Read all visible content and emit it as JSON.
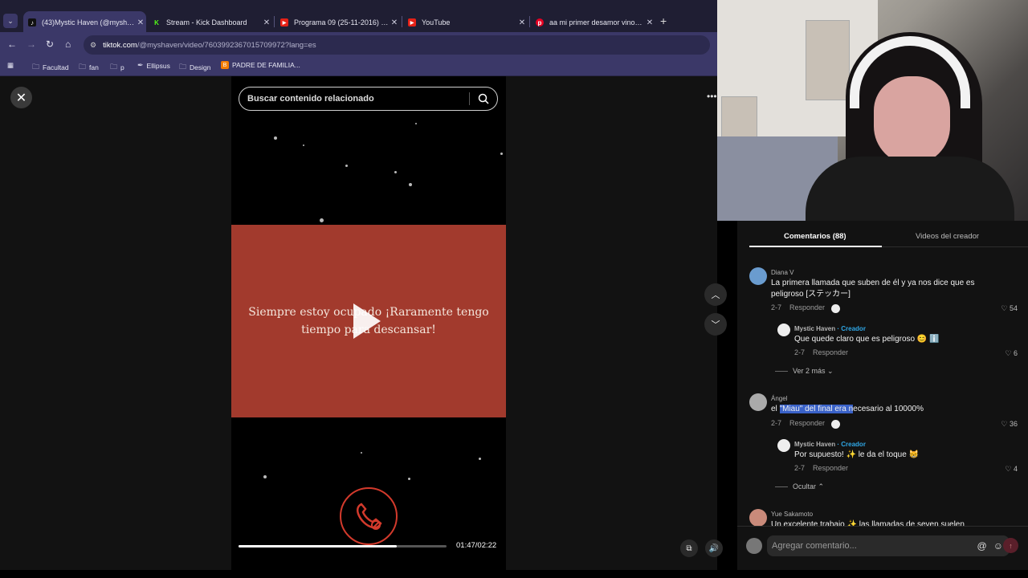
{
  "browser": {
    "tabs": [
      {
        "title": "(43)Mystic Haven (@myshaven",
        "favicon": "tiktok-icon",
        "active": true
      },
      {
        "title": "Stream - Kick Dashboard",
        "favicon": "kick-icon",
        "active": false
      },
      {
        "title": "Programa 09 (25-11-2016) Pes",
        "favicon": "youtube-icon",
        "active": false
      },
      {
        "title": "YouTube",
        "favicon": "youtube-icon",
        "active": false
      },
      {
        "title": "aa mi primer desamor vino de",
        "favicon": "pinterest-icon",
        "active": false
      }
    ],
    "new_tab": "+",
    "url_host": "tiktok.com",
    "url_path": "/@myshaven/video/7603992367015709972?lang=es",
    "bookmarks": [
      {
        "label": "Facultad",
        "icon": "folder-icon"
      },
      {
        "label": "fan",
        "icon": "folder-icon"
      },
      {
        "label": "p",
        "icon": "folder-icon"
      },
      {
        "label": "Ellipsus",
        "icon": "ellipsus-icon"
      },
      {
        "label": "Design",
        "icon": "folder-icon"
      },
      {
        "label": "PADRE DE FAMILIA...",
        "icon": "blogger-icon"
      }
    ]
  },
  "video": {
    "search_placeholder": "Buscar contenido relacionado",
    "card_text": "Siempre estoy ocupado ¡Raramente tengo tiempo para descansar!",
    "time": "01:47/02:22",
    "progress": 0.76,
    "card_color": "#a23a2d",
    "accent": "#d33a2c"
  },
  "panel": {
    "tab_comments": "Comentarios (88)",
    "tab_creator_videos": "Videos del creador",
    "reply_label": "Responder",
    "comments": [
      {
        "user": "Diana V",
        "text": "La primera llamada que suben de él y ya nos dice que es",
        "text2": "peligroso [ステッカー]",
        "date": "2-7",
        "likes": "54"
      },
      {
        "user": "Mystic Haven",
        "creator_tag": " · Creador",
        "text": "Que quede claro que es peligroso 😊 ℹ️",
        "date": "2-7",
        "likes": "6"
      },
      {
        "expand": "Ver 2 más"
      },
      {
        "user": "Ángel",
        "text_pre": "el ",
        "text_hl": "\"Miau\" del final era n",
        "text_post": "ecesario al 10000%",
        "date": "2-7",
        "likes": "36"
      },
      {
        "user": "Mystic Haven",
        "creator_tag": " · Creador",
        "text": "Por supuesto! ✨ le da el toque 😸",
        "date": "2-7",
        "likes": "4"
      },
      {
        "expand": "Ocultar"
      },
      {
        "user": "Yue Sakamoto",
        "text": "Un excelente trabajo ✨ las llamadas de seven suelen"
      }
    ],
    "input_placeholder": "Agregar comentario..."
  }
}
